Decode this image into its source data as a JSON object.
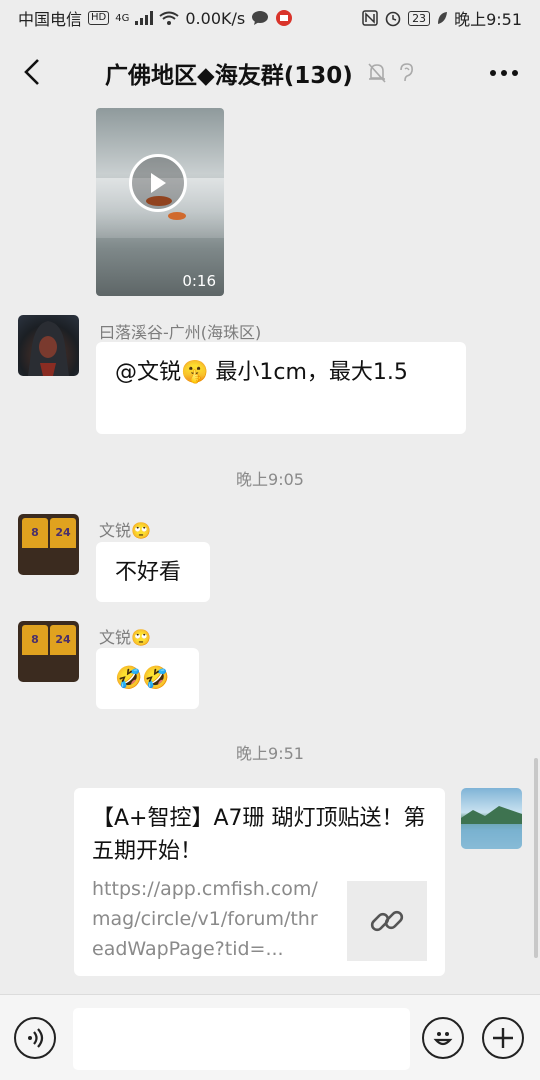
{
  "status_bar": {
    "carrier": "中国电信",
    "hd": "HD",
    "network": "4G",
    "speed": "0.00K/s",
    "battery": "23",
    "time": "晚上9:51"
  },
  "header": {
    "title": "广佛地区◆海友群(130)"
  },
  "messages": {
    "video_duration": "0:16",
    "msg1": {
      "sender": "曰落溪谷-广州(海珠区)",
      "text": "@文锐🤫 最小1cm，最大1.5"
    },
    "time1": "晚上9:05",
    "msg2": {
      "sender": "文锐🙄",
      "text": "不好看"
    },
    "msg3": {
      "sender": "文锐🙄",
      "text": "🤣🤣"
    },
    "time2": "晚上9:51",
    "link_card": {
      "title": "【A+智控】A7珊 瑚灯顶贴送！第五期开始！",
      "url": "https://app.cmfish.com/mag/circle/v1/forum/threadWapPage?tid=..."
    }
  },
  "input": {
    "placeholder": ""
  },
  "colors": {
    "background": "#ededed",
    "bubble": "#ffffff",
    "sender_text": "#7d7d7d"
  }
}
